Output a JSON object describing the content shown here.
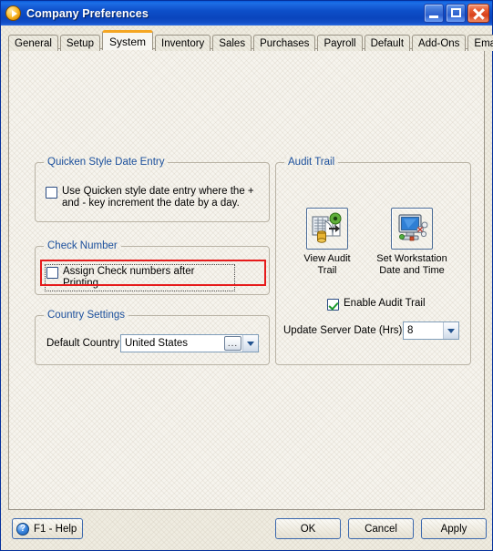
{
  "window": {
    "title": "Company Preferences",
    "icon": "app-orb-icon",
    "controls": {
      "minimize": "minimize-icon",
      "maximize": "maximize-icon",
      "close": "close-icon"
    }
  },
  "tabs": [
    {
      "label": "General",
      "active": false
    },
    {
      "label": "Setup",
      "active": false
    },
    {
      "label": "System",
      "active": true
    },
    {
      "label": "Inventory",
      "active": false
    },
    {
      "label": "Sales",
      "active": false
    },
    {
      "label": "Purchases",
      "active": false
    },
    {
      "label": "Payroll",
      "active": false
    },
    {
      "label": "Default",
      "active": false
    },
    {
      "label": "Add-Ons",
      "active": false
    },
    {
      "label": "Email Setup",
      "active": false
    }
  ],
  "groups": {
    "quicken": {
      "title": "Quicken Style Date Entry",
      "checkbox": {
        "label": "Use Quicken style date entry where the + and - key increment the date by a day.",
        "checked": false
      }
    },
    "check_number": {
      "title": "Check Number",
      "checkbox": {
        "label": "Assign Check numbers after Printing.",
        "checked": false,
        "focused": true,
        "highlighted": true
      }
    },
    "country": {
      "title": "Country Settings",
      "field_label": "Default Country",
      "value": "United States",
      "ellipsis_label": "...",
      "dropdown_icon": "chevron-down-icon"
    },
    "audit": {
      "title": "Audit Trail",
      "buttons": [
        {
          "caption": "View Audit\nTrail",
          "icon": "view-audit-trail-icon"
        },
        {
          "caption": "Set Workstation\nDate and Time",
          "icon": "set-workstation-clock-icon"
        }
      ],
      "enable_checkbox": {
        "label": "Enable Audit Trail",
        "checked": true
      },
      "update_label": "Update Server Date (Hrs)",
      "update_value": "8"
    }
  },
  "footer": {
    "help": "F1 - Help",
    "help_icon": "?",
    "ok": "OK",
    "cancel": "Cancel",
    "apply": "Apply"
  },
  "colors": {
    "title_blue": "#0831d9",
    "accent_orange": "#f5a623",
    "group_title_blue": "#1b4f9c",
    "highlight_red": "#e61b1b",
    "check_green": "#1a9a2c",
    "panel_bg": "#f6f4ee"
  }
}
